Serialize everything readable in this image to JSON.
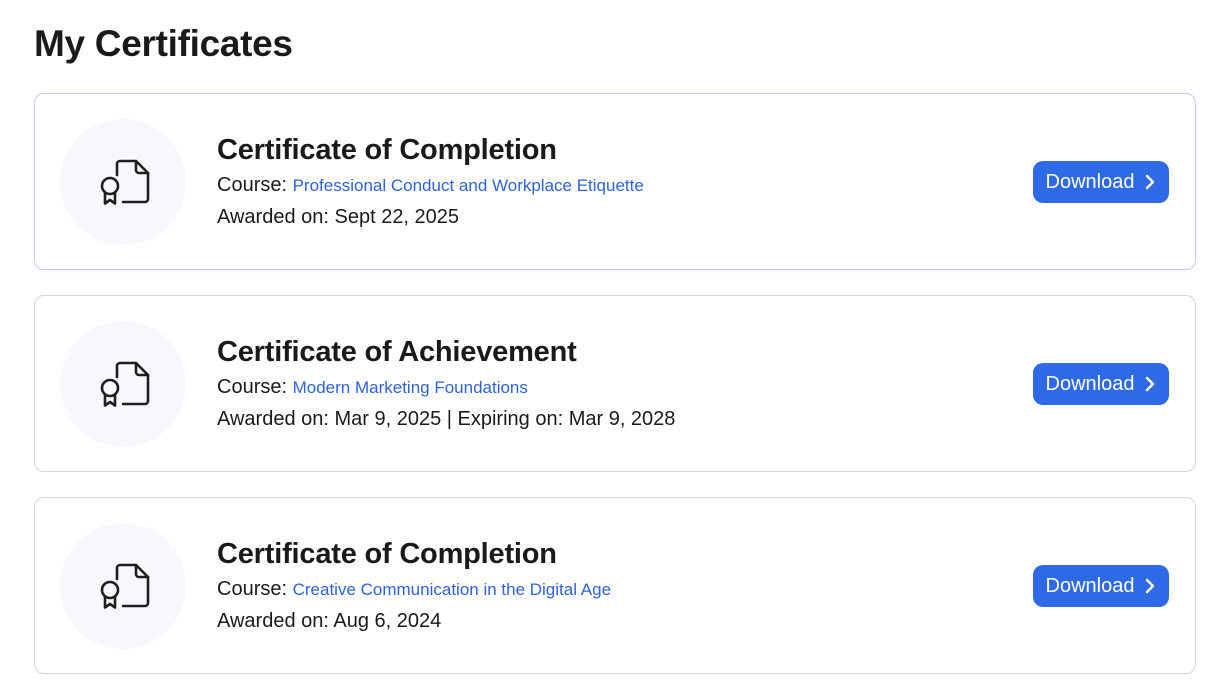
{
  "page": {
    "title": "My Certificates"
  },
  "theme": {
    "accent": "#2f6ae6",
    "link": "#2f62d9",
    "text": "#1a1a1a",
    "card_border": "#d3d6de",
    "icon_bg": "#f7f8fb"
  },
  "certificates": [
    {
      "title": "Certificate of Completion",
      "course_label": "Course:",
      "course_name": "Professional Conduct and Workplace Etiquette",
      "dates": "Awarded on: Sept 22, 2025",
      "icon": "certificate-document-icon",
      "download_label": "Download",
      "download_icon": "chevron-right-icon"
    },
    {
      "title": "Certificate of Achievement",
      "course_label": "Course:",
      "course_name": "Modern Marketing Foundations",
      "dates": "Awarded on: Mar 9, 2025 | Expiring on: Mar 9, 2028",
      "icon": "certificate-document-icon",
      "download_label": "Download",
      "download_icon": "chevron-right-icon"
    },
    {
      "title": "Certificate of Completion",
      "course_label": "Course:",
      "course_name": "Creative Communication in the Digital Age",
      "dates": "Awarded on: Aug 6, 2024",
      "icon": "certificate-document-icon",
      "download_label": "Download",
      "download_icon": "chevron-right-icon"
    }
  ]
}
